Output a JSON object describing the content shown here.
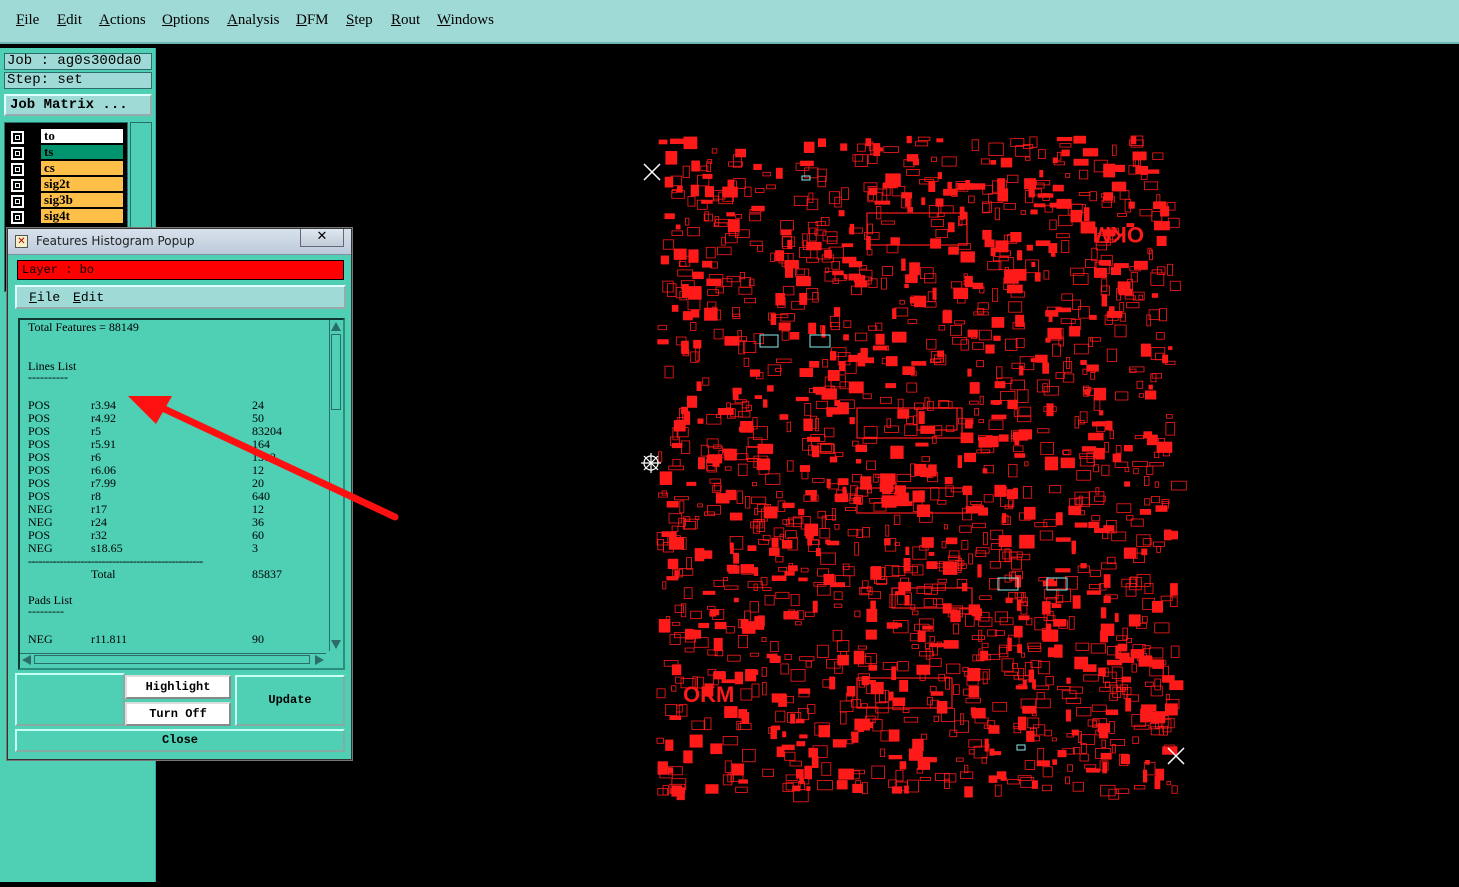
{
  "menubar": {
    "items": [
      "File",
      "Edit",
      "Actions",
      "Options",
      "Analysis",
      "DFM",
      "Step",
      "Rout",
      "Windows"
    ]
  },
  "left_panel": {
    "job": "Job : ag0s300da0",
    "step": "Step: set",
    "job_matrix_button": "Job Matrix ...",
    "layers": [
      {
        "name": "to",
        "color": "#ffffff"
      },
      {
        "name": "ts",
        "color": "#00956e"
      },
      {
        "name": "cs",
        "color": "#ffc04a"
      },
      {
        "name": "sig2t",
        "color": "#ffc04a"
      },
      {
        "name": "sig3b",
        "color": "#ffc04a"
      },
      {
        "name": "sig4t",
        "color": "#ffc04a"
      }
    ]
  },
  "popup": {
    "title": "Features Histogram Popup",
    "close_glyph": "✕",
    "layer_label": "Layer :  bo",
    "menu": [
      "File",
      "Edit"
    ],
    "total_features": "Total Features = 88149",
    "lines_heading": "Lines List",
    "lines_underline": "----------",
    "lines": [
      {
        "pol": "POS",
        "sym": "r3.94",
        "count": "24"
      },
      {
        "pol": "POS",
        "sym": "r4.92",
        "count": "50"
      },
      {
        "pol": "POS",
        "sym": "r5",
        "count": "83204"
      },
      {
        "pol": "POS",
        "sym": "r5.91",
        "count": "164"
      },
      {
        "pol": "POS",
        "sym": "r6",
        "count": "1512"
      },
      {
        "pol": "POS",
        "sym": "r6.06",
        "count": "12"
      },
      {
        "pol": "POS",
        "sym": "r7.99",
        "count": "20"
      },
      {
        "pol": "POS",
        "sym": "r8",
        "count": "640"
      },
      {
        "pol": "NEG",
        "sym": "r17",
        "count": "12"
      },
      {
        "pol": "NEG",
        "sym": "r24",
        "count": "36"
      },
      {
        "pol": "POS",
        "sym": "r32",
        "count": "60"
      },
      {
        "pol": "NEG",
        "sym": "s18.65",
        "count": "3"
      }
    ],
    "total_rule": "--------------------------------------------------",
    "total_label": "Total",
    "total_value": "85837",
    "pads_heading": "Pads List",
    "pads_underline": "---------",
    "pads": [
      {
        "pol": "NEG",
        "sym": "r11.811",
        "count": "90"
      }
    ],
    "buttons": {
      "highlight": "Highlight",
      "turn_off": "Turn Off",
      "update": "Update",
      "close": "Close"
    }
  },
  "canvas": {
    "board_text_top": "OKM",
    "board_text_bottom": "OKM",
    "board_color": "#ff1a1a",
    "annotation_color": "#ff1010"
  }
}
